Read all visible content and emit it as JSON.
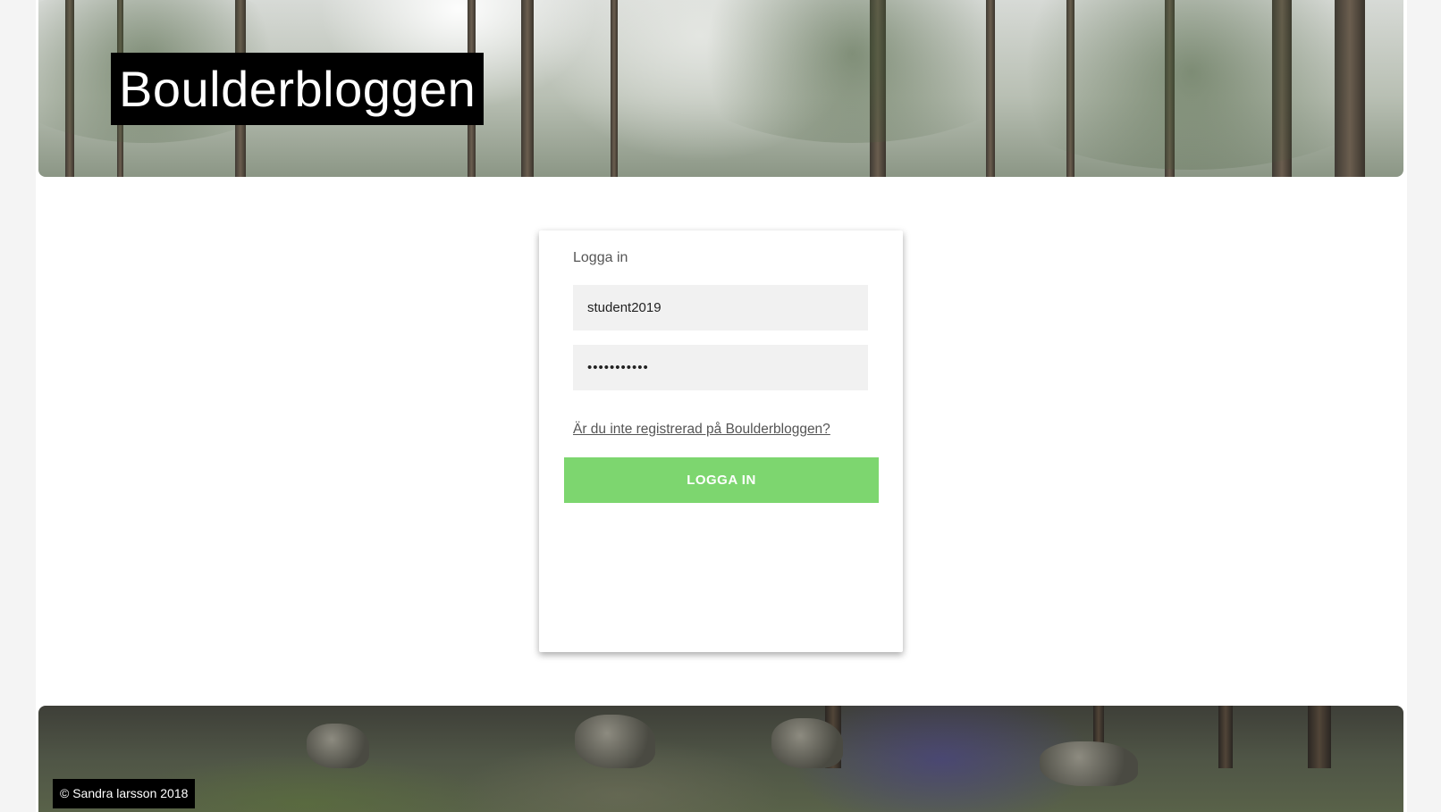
{
  "header": {
    "site_title": "Boulderbloggen"
  },
  "login": {
    "heading": "Logga in",
    "username_value": "student2019",
    "password_value": "•••••••••••",
    "register_link": "Är du inte registrerad på Boulderbloggen?",
    "submit_label": "LOGGA IN"
  },
  "footer": {
    "copyright": "© Sandra larsson 2018"
  },
  "colors": {
    "button": "#7dd66f",
    "title_bg": "#000000",
    "field_bg": "#f1f1f1"
  }
}
